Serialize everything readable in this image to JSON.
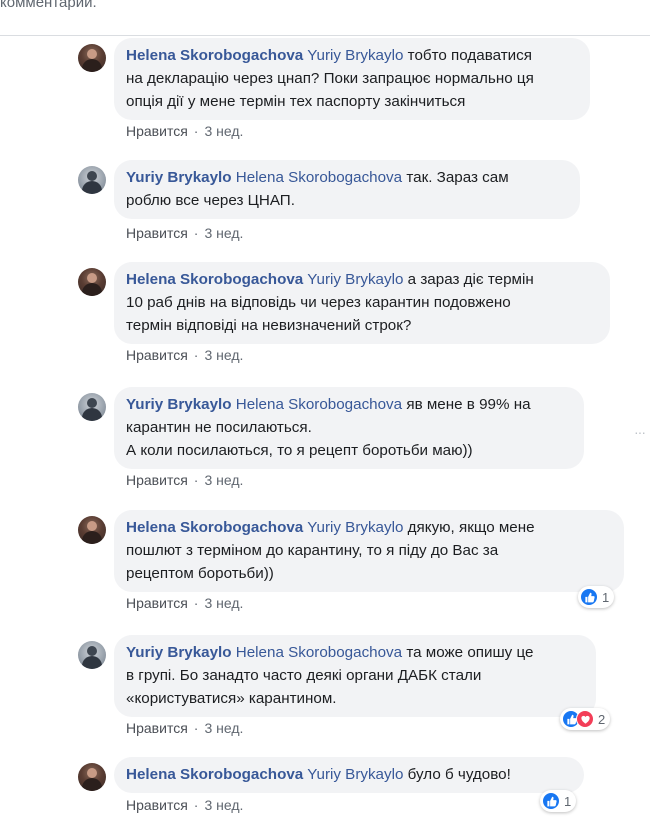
{
  "header": {
    "text": "комментарии."
  },
  "comments": [
    {
      "author": "Helena Skorobogachova",
      "mention": "Yuriy Brykaylo",
      "lines": [
        "тобто подаватися",
        "на декларацію через цнап? Поки запрацює нормально ця",
        "опція дії у мене термін тех паспорту закінчиться"
      ],
      "like_label": "Нравится",
      "time": "3 нед.",
      "avatar": "helena-avatar"
    },
    {
      "author": "Yuriy Brykaylo",
      "mention": "Helena Skorobogachova",
      "lines": [
        "так. Зараз сам",
        "роблю все через ЦНАП."
      ],
      "like_label": "Нравится",
      "time": "3 нед.",
      "avatar": "yuriy-avatar"
    },
    {
      "author": "Helena Skorobogachova",
      "mention": "Yuriy Brykaylo",
      "lines": [
        "а зараз діє термін",
        "10 раб днів на відповідь чи через карантин подовжено",
        "термін відповіді на невизначений строк?"
      ],
      "like_label": "Нравится",
      "time": "3 нед.",
      "avatar": "helena-avatar"
    },
    {
      "author": "Yuriy Brykaylo",
      "mention": "Helena Skorobogachova",
      "lines": [
        "яв мене в 99% на",
        "карантин не посилаються.",
        "А коли посилаються, то я рецепт боротьби маю))"
      ],
      "like_label": "Нравится",
      "time": "3 нед.",
      "avatar": "yuriy-avatar"
    },
    {
      "author": "Helena Skorobogachova",
      "mention": "Yuriy Brykaylo",
      "lines": [
        "дякую, якщо мене",
        "пошлют з терміном до карантину, то я піду до Вас за",
        "рецептом боротьби))"
      ],
      "like_label": "Нравится",
      "time": "3 нед.",
      "avatar": "helena-avatar",
      "reactions": {
        "types": [
          "like"
        ],
        "count": "1"
      }
    },
    {
      "author": "Yuriy Brykaylo",
      "mention": "Helena Skorobogachova",
      "lines": [
        "та може опишу це",
        "в групі. Бо занадто часто деякі органи ДАБК стали",
        "«користуватися» карантином."
      ],
      "like_label": "Нравится",
      "time": "3 нед.",
      "avatar": "yuriy-avatar",
      "reactions": {
        "types": [
          "like",
          "love"
        ],
        "count": "2"
      }
    },
    {
      "author": "Helena Skorobogachova",
      "mention": "Yuriy Brykaylo",
      "lines": [
        "було б чудово!"
      ],
      "like_label": "Нравится",
      "time": "3 нед.",
      "avatar": "helena-avatar",
      "reactions": {
        "types": [
          "like"
        ],
        "count": "1"
      }
    }
  ],
  "side_marker": "···",
  "colors": {
    "link": "#385898",
    "bubble": "#f2f3f5",
    "like": "#1877f2",
    "love": "#f33e58",
    "meta": "#606770"
  }
}
